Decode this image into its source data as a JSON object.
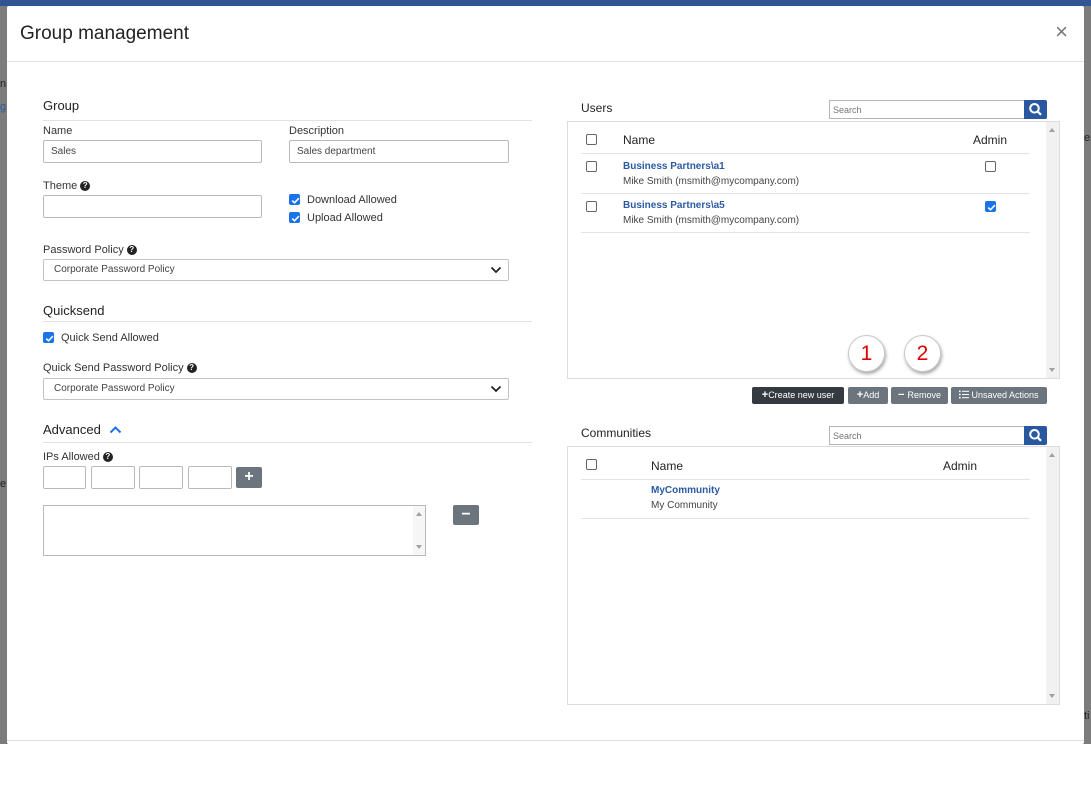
{
  "background_fragments": [
    "n",
    "g",
    "e",
    "en",
    "ti"
  ],
  "modal": {
    "title": "Group management",
    "close_symbol": "×"
  },
  "group": {
    "section_title": "Group",
    "name_label": "Name",
    "name_value": "Sales",
    "description_label": "Description",
    "description_value": "Sales department",
    "theme_label": "Theme",
    "theme_value": "",
    "download_allowed": {
      "label": "Download Allowed",
      "checked": true
    },
    "upload_allowed": {
      "label": "Upload Allowed",
      "checked": true
    },
    "password_policy_label": "Password Policy",
    "password_policy_value": "Corporate Password Policy"
  },
  "quicksend": {
    "section_title": "Quicksend",
    "quick_send_allowed": {
      "label": "Quick Send Allowed",
      "checked": true
    },
    "password_policy_label": "Quick Send Password Policy",
    "password_policy_value": "Corporate Password Policy"
  },
  "advanced": {
    "section_title": "Advanced",
    "ips_label": "IPs Allowed",
    "ip_octets": [
      "",
      "",
      "",
      ""
    ],
    "add_symbol": "+",
    "remove_symbol": "−",
    "ip_list_value": ""
  },
  "users": {
    "title": "Users",
    "search_placeholder": "Search",
    "columns": {
      "name": "Name",
      "admin": "Admin"
    },
    "rows": [
      {
        "name": "Business Partners\\a1",
        "detail": "Mike Smith (msmith@mycompany.com)",
        "admin": false
      },
      {
        "name": "Business Partners\\a5",
        "detail": "Mike Smith (msmith@mycompany.com)",
        "admin": true
      }
    ],
    "buttons": {
      "create": "Create new user",
      "add": "Add",
      "remove": "Remove",
      "unsaved": "Unsaved Actions"
    }
  },
  "markers": [
    "1",
    "2"
  ],
  "communities": {
    "title": "Communities",
    "search_placeholder": "Search",
    "columns": {
      "name": "Name",
      "admin": "Admin"
    },
    "rows": [
      {
        "name": "MyCommunity",
        "detail": "My Community"
      }
    ]
  },
  "colors": {
    "accent": "#1a73e8",
    "link": "#2b5aa3",
    "search_button": "#2a58a0",
    "marker_text": "#e00000"
  }
}
